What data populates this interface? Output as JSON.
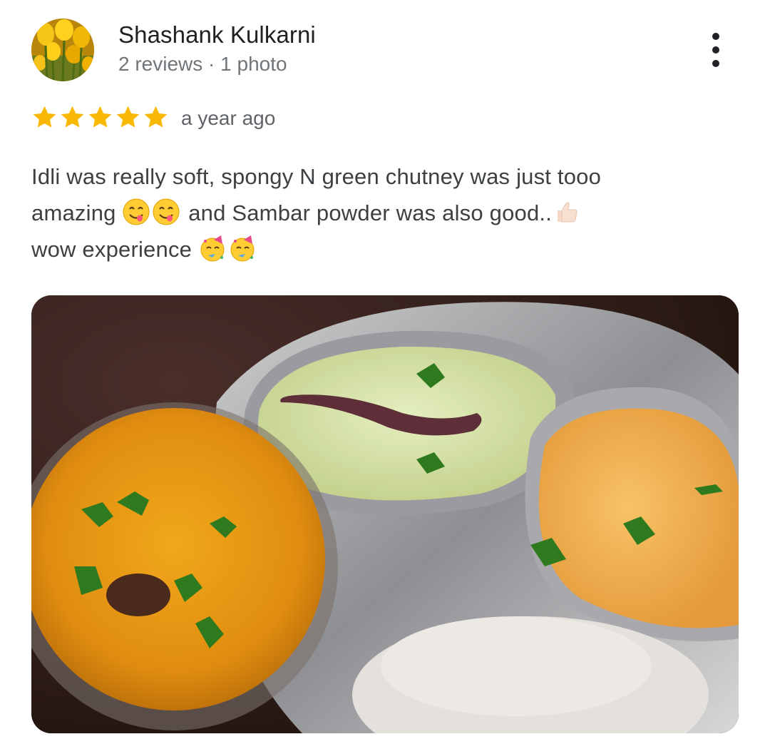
{
  "reviewer": {
    "name": "Shashank Kulkarni",
    "meta": "2 reviews · 1 photo",
    "avatar_icon": "tulip-flowers-avatar"
  },
  "menu": {
    "icon": "more-vert-icon"
  },
  "rating": {
    "stars": 5,
    "max": 5,
    "color": "#f9b803",
    "time": "a year ago"
  },
  "review": {
    "line1": "Idli was really soft, spongy N green chutney was just tooo",
    "line2_a": "amazing",
    "line2_b": "and Sambar powder was also good..",
    "line3": "wow experience"
  },
  "emojis": {
    "yum": "face-savoring-food-emoji",
    "thumbs": "thumbs-up-emoji",
    "party": "partying-face-emoji"
  },
  "photo": {
    "subject": "food-photo"
  }
}
